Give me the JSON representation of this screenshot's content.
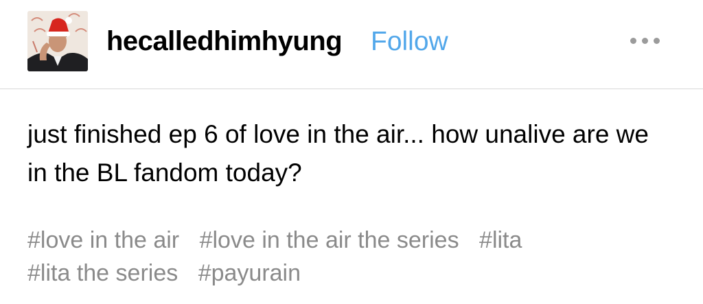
{
  "post": {
    "username": "hecalledhimhyung",
    "follow_label": "Follow",
    "more_icon": "ellipsis-horizontal-icon",
    "body": "just finished ep 6 of love in the air... how unalive are we in the BL fandom today?",
    "tags": [
      "#love in the air",
      "#love in the air the series",
      "#lita",
      "#lita the series",
      "#payurain"
    ]
  },
  "colors": {
    "follow": "#52a7ea",
    "tags": "#8a8a8a",
    "divider": "#d8d8d8",
    "more_dots": "#9b9b9b"
  }
}
